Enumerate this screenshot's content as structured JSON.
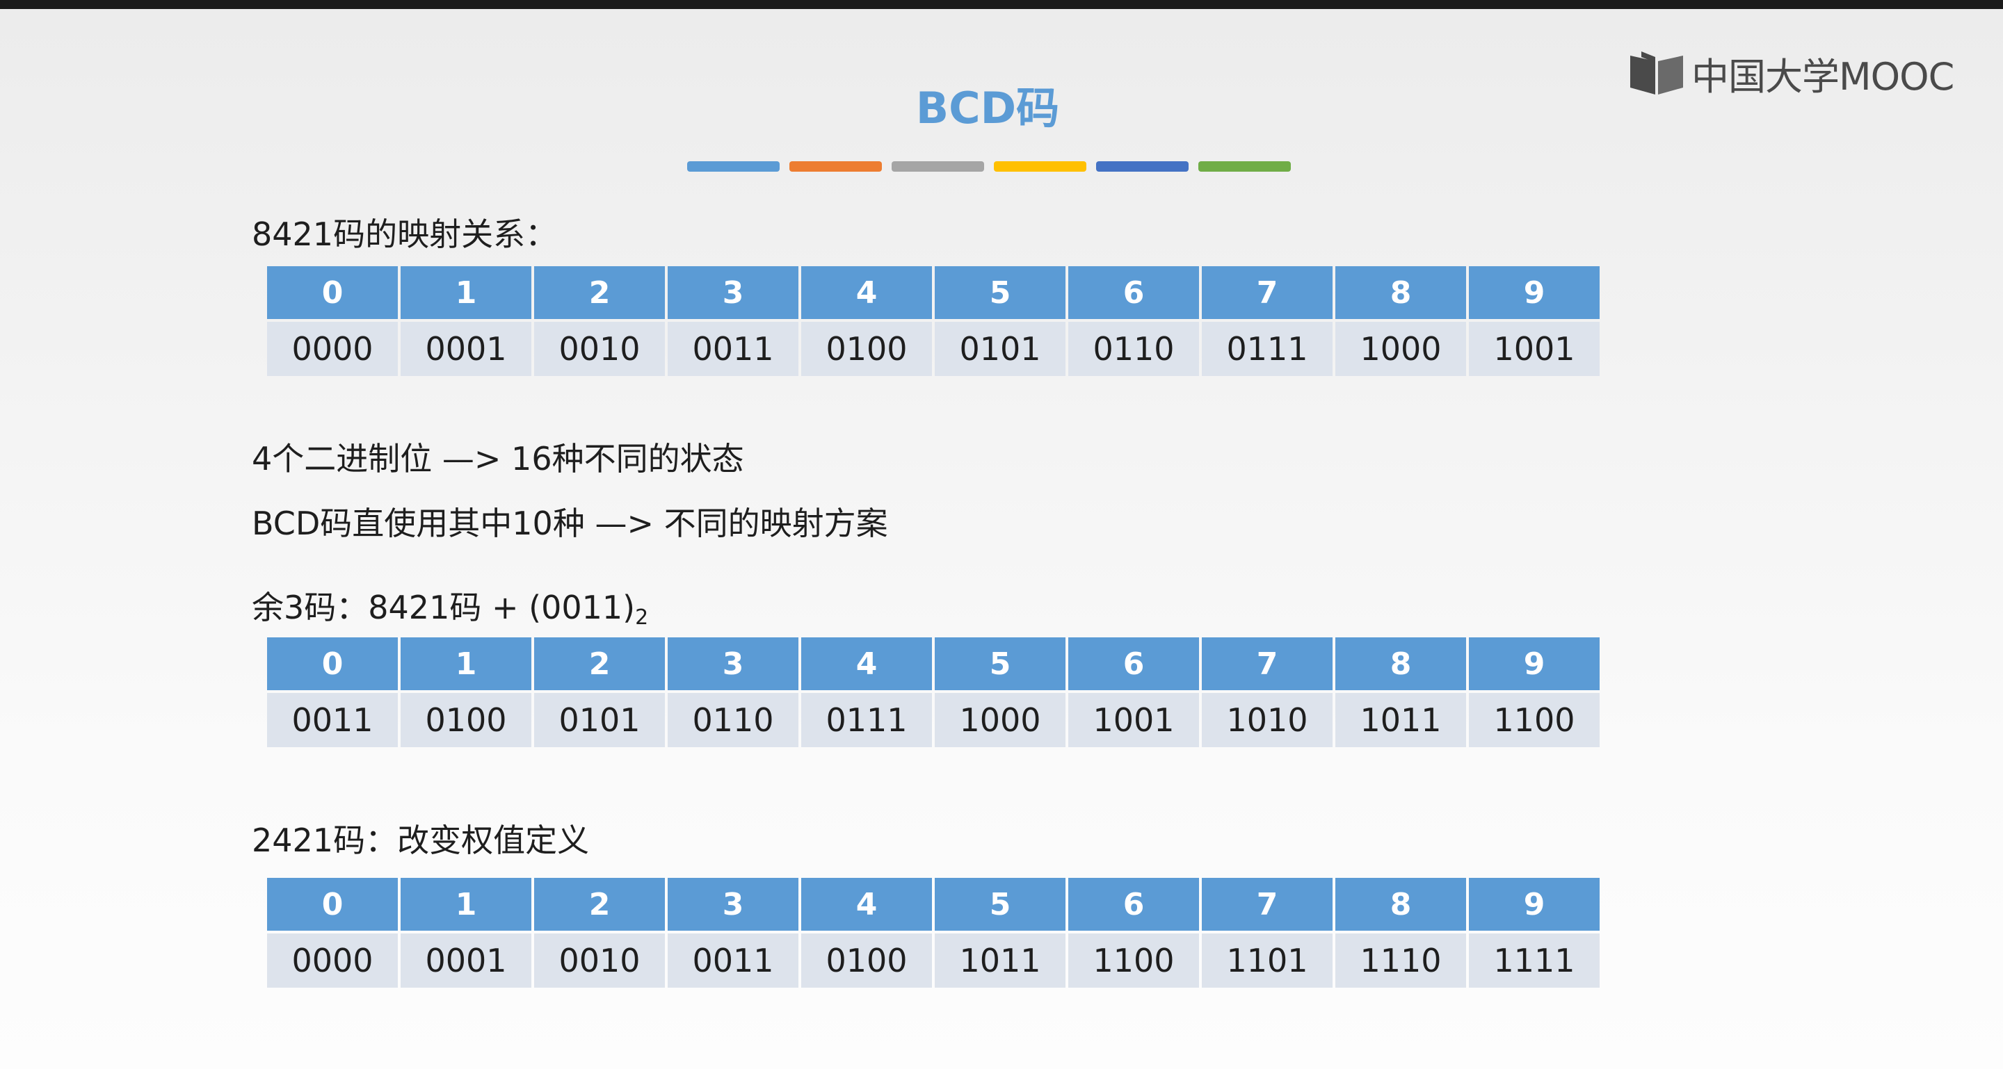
{
  "slide": {
    "title": "BCD码",
    "logo_text": "中国大学MOOC",
    "accent_colors": [
      "#5b9bd5",
      "#ed7d31",
      "#a5a5a5",
      "#ffc000",
      "#4472c4",
      "#70ad47"
    ],
    "section1_label": "8421码的映射关系：",
    "table1": {
      "digits": [
        "0",
        "1",
        "2",
        "3",
        "4",
        "5",
        "6",
        "7",
        "8",
        "9"
      ],
      "codes": [
        "0000",
        "0001",
        "0010",
        "0011",
        "0100",
        "0101",
        "0110",
        "0111",
        "1000",
        "1001"
      ]
    },
    "note1": "4个二进制位  —> 16种不同的状态",
    "note2": "BCD码直使用其中10种  —> 不同的映射方案",
    "section2_label_main": "余3码：8421码 + (0011)",
    "section2_label_sub": "2",
    "table2": {
      "digits": [
        "0",
        "1",
        "2",
        "3",
        "4",
        "5",
        "6",
        "7",
        "8",
        "9"
      ],
      "codes": [
        "0011",
        "0100",
        "0101",
        "0110",
        "0111",
        "1000",
        "1001",
        "1010",
        "1011",
        "1100"
      ]
    },
    "section3_label": "2421码：改变权值定义",
    "table3": {
      "digits": [
        "0",
        "1",
        "2",
        "3",
        "4",
        "5",
        "6",
        "7",
        "8",
        "9"
      ],
      "codes": [
        "0000",
        "0001",
        "0010",
        "0011",
        "0100",
        "1011",
        "1100",
        "1101",
        "1110",
        "1111"
      ]
    }
  }
}
